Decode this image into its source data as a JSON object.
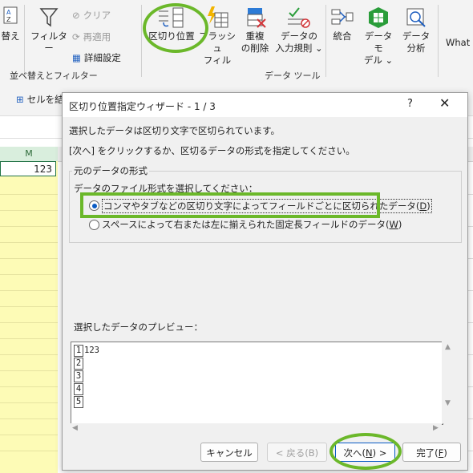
{
  "ribbon": {
    "sort_label": "替え",
    "filter_label": "フィルター",
    "clear_label": "クリア",
    "reapply_label": "再適用",
    "advanced_label": "詳細設定",
    "sort_filter_group": "並べ替えとフィルター",
    "text_to_columns_label": "区切り位置",
    "flash_fill_label": "フラッシュ\nフィル",
    "flash_fill_l1": "フラッシュ",
    "flash_fill_l2": "フィル",
    "remove_dup_l1": "重複",
    "remove_dup_l2": "の削除",
    "validation_l1": "データの",
    "validation_l2": "入力規則 ⌄",
    "consolidate_label": "統合",
    "data_model_l1": "データ モ",
    "data_model_l2": "デル ⌄",
    "analysis_l1": "データ",
    "analysis_l2": "分析",
    "whatif_label": "What",
    "data_tools_group": "データ ツール"
  },
  "sheet": {
    "format_cells_label": "セルを結",
    "column_header": "M",
    "cell_value": "123"
  },
  "dialog": {
    "title": "区切り位置指定ウィザード - 1 / 3",
    "help": "?",
    "close": "✕",
    "line1": "選択したデータは区切り文字で区切られています。",
    "line2": "[次へ] をクリックするか、区切るデータの形式を指定してください。",
    "original_format_legend": "元のデータの形式",
    "select_type_label": "データのファイル形式を選択してください：",
    "option_delimited": "コンマやタブなどの区切り文字によってフィールドごとに区切られたデータ(",
    "option_delimited_key": "D",
    "option_fixed": "スペースによって右または左に揃えられた固定長フィールドのデータ(",
    "option_fixed_key": "W",
    "preview_label": "選択したデータのプレビュー：",
    "preview_rows": [
      {
        "num": "1",
        "text": "123"
      },
      {
        "num": "2",
        "text": ""
      },
      {
        "num": "3",
        "text": ""
      },
      {
        "num": "4",
        "text": ""
      },
      {
        "num": "5",
        "text": ""
      }
    ],
    "buttons": {
      "cancel": "キャンセル",
      "back": "< 戻る(B)",
      "next_pre": "次へ(",
      "next_key": "N",
      "next_post": ") >",
      "finish_pre": "完了(",
      "finish_key": "F",
      "finish_post": ")"
    }
  },
  "colors": {
    "highlight": "#6bb82a",
    "cell_fill": "#fdfbb6",
    "accent": "#0a5bc4"
  }
}
